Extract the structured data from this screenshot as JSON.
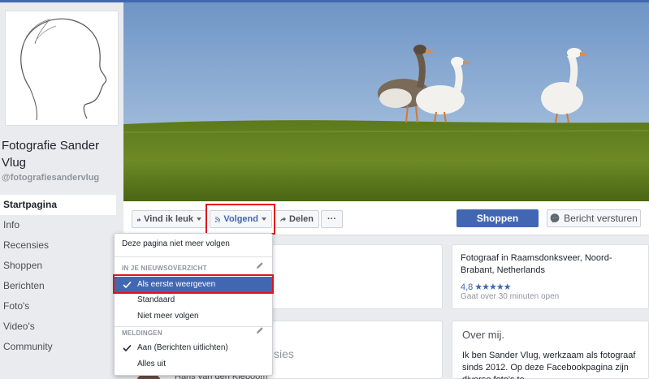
{
  "page": {
    "name": "Fotografie Sander Vlug",
    "handle": "@fotografiesandervlug"
  },
  "nav": [
    {
      "label": "Startpagina",
      "active": true
    },
    {
      "label": "Info"
    },
    {
      "label": "Recensies"
    },
    {
      "label": "Shoppen"
    },
    {
      "label": "Berichten"
    },
    {
      "label": "Foto's"
    },
    {
      "label": "Video's"
    },
    {
      "label": "Community"
    }
  ],
  "actions": {
    "like": "Vind ik leuk",
    "follow": "Volgend",
    "share": "Delen",
    "more": "···",
    "shop": "Shoppen",
    "message": "Bericht versturen"
  },
  "dropdown": {
    "unfollow_page": "Deze pagina niet meer volgen",
    "newsfeed_header": "IN JE NIEUWSOVERZICHT",
    "see_first": "Als eerste weergeven",
    "default": "Standaard",
    "unfollow": "Niet meer volgen",
    "notifications_header": "MELDINGEN",
    "notif_on": "Aan (Berichten uitlichten)",
    "notif_off": "Alles uit"
  },
  "info": {
    "location": "Fotograaf in Raamsdonksveer, Noord-Brabant, Netherlands",
    "rating": "4,8",
    "stars": "★★★★★",
    "open_status": "Gaat over 30 minuten open"
  },
  "about": {
    "title": "Over mij.",
    "text": "Ik ben Sander Vlug, werkzaam als fotograaf sinds 2012. Op deze Facebookpagina zijn diverse foto's te"
  },
  "middle": {
    "reviews_partial": "sies",
    "post_partial": "Hans van den Kieboom"
  },
  "colors": {
    "brand": "#4267b2",
    "highlight_box": "#e0131b"
  }
}
